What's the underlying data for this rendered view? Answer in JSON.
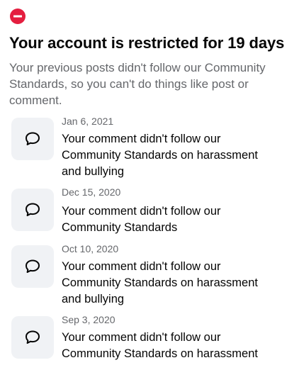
{
  "status": {
    "icon": "restricted-icon",
    "icon_color": "#e41e3f",
    "title": "Your account is restricted for 19 days",
    "description": "Your previous posts didn't follow our Community Standards, so you can't do things like post or comment."
  },
  "violations": [
    {
      "icon": "comment-icon",
      "date": "Jan 6, 2021",
      "text": "Your comment didn't follow our Community Standards on harassment and bullying"
    },
    {
      "icon": "comment-icon",
      "date": "Dec 15, 2020",
      "text": "Your comment didn't follow our Community Standards"
    },
    {
      "icon": "comment-icon",
      "date": "Oct 10, 2020",
      "text": "Your comment didn't follow our Community Standards on harassment and bullying"
    },
    {
      "icon": "comment-icon",
      "date": "Sep 3, 2020",
      "text": "Your comment didn't follow our Community Standards on harassment"
    }
  ]
}
